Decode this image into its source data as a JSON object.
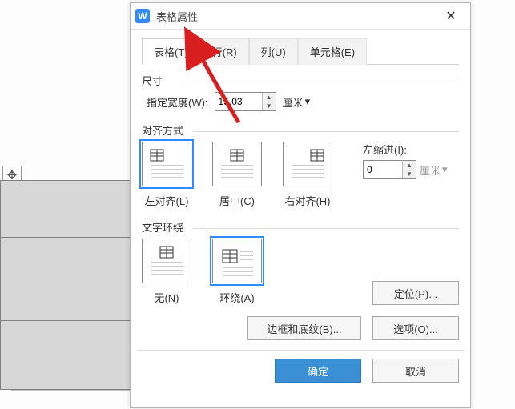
{
  "dialog": {
    "title": "表格属性",
    "appicon_letter": "W"
  },
  "tabs": [
    {
      "label": "表格(T)",
      "active": true
    },
    {
      "label": "行(R)",
      "active": false
    },
    {
      "label": "列(U)",
      "active": false
    },
    {
      "label": "单元格(E)",
      "active": false
    }
  ],
  "size": {
    "legend": "尺寸",
    "width_label": "指定宽度(W):",
    "width_value": "15.03",
    "unit_label": "厘米",
    "unit_caret": "▾"
  },
  "align": {
    "legend": "对齐方式",
    "options": [
      {
        "label": "左对齐(L)",
        "selected": true
      },
      {
        "label": "居中(C)",
        "selected": false
      },
      {
        "label": "右对齐(H)",
        "selected": false
      }
    ],
    "indent_label": "左缩进(I):",
    "indent_value": "0",
    "indent_unit": "厘米",
    "indent_unit_caret": "▾"
  },
  "wrap": {
    "legend": "文字环绕",
    "options": [
      {
        "label": "无(N)",
        "selected": false
      },
      {
        "label": "环绕(A)",
        "selected": true
      }
    ],
    "position_button": "定位(P)..."
  },
  "bottom": {
    "border_button": "边框和底纹(B)...",
    "options_button": "选项(O)..."
  },
  "footer": {
    "ok": "确定",
    "cancel": "取消"
  },
  "bg": {
    "move_glyph": "✥"
  }
}
